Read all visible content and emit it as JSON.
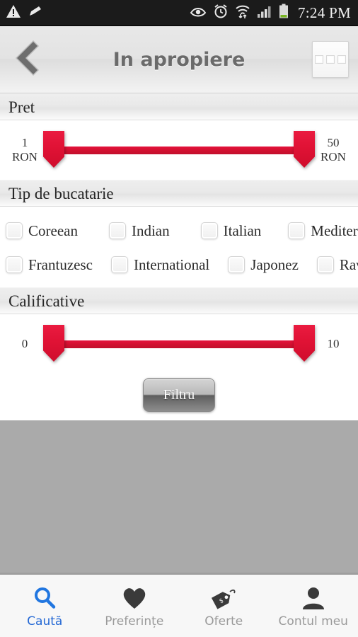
{
  "statusbar": {
    "time": "7:24 PM",
    "left_icons": [
      "warning-triangle-icon",
      "pencil-icon"
    ],
    "right_icons": [
      "eye-icon",
      "alarm-clock-icon",
      "wifi-icon",
      "signal-bars-icon",
      "battery-icon"
    ]
  },
  "header": {
    "title": "In apropiere",
    "back_icon": "chevron-left-icon",
    "menu_icon": "overflow-menu-icon"
  },
  "sections": {
    "price": {
      "title": "Pret",
      "min_label": "1\nRON",
      "max_label": "50\nRON",
      "min_value": "1",
      "max_value": "50",
      "unit": "RON"
    },
    "cuisine": {
      "title": "Tip de bucatarie",
      "rows": [
        [
          {
            "label": "Coreean",
            "checked": false
          },
          {
            "label": "Indian",
            "checked": false
          },
          {
            "label": "Italian",
            "checked": false
          },
          {
            "label": "Mediteranean",
            "checked": false
          }
        ],
        [
          {
            "label": "Frantuzesc",
            "checked": false
          },
          {
            "label": "International",
            "checked": false
          },
          {
            "label": "Japonez",
            "checked": false
          },
          {
            "label": "Raw-Vegan",
            "checked": false
          }
        ]
      ]
    },
    "rating": {
      "title": "Calificative",
      "min_label": "0",
      "max_label": "10",
      "min_value": "0",
      "max_value": "10"
    }
  },
  "filter_button": {
    "label": "Filtru"
  },
  "bottomnav": {
    "items": [
      {
        "label": "Caută",
        "icon": "search-icon",
        "active": true
      },
      {
        "label": "Preferințe",
        "icon": "heart-icon",
        "active": false
      },
      {
        "label": "Oferte",
        "icon": "price-tag-icon",
        "active": false
      },
      {
        "label": "Contul meu",
        "icon": "person-icon",
        "active": false
      }
    ]
  },
  "colors": {
    "accent_red": "#d0102f",
    "active_blue": "#2468d4",
    "statusbar_bg": "#1b1b1b",
    "filler_gray": "#aaaaaa"
  }
}
